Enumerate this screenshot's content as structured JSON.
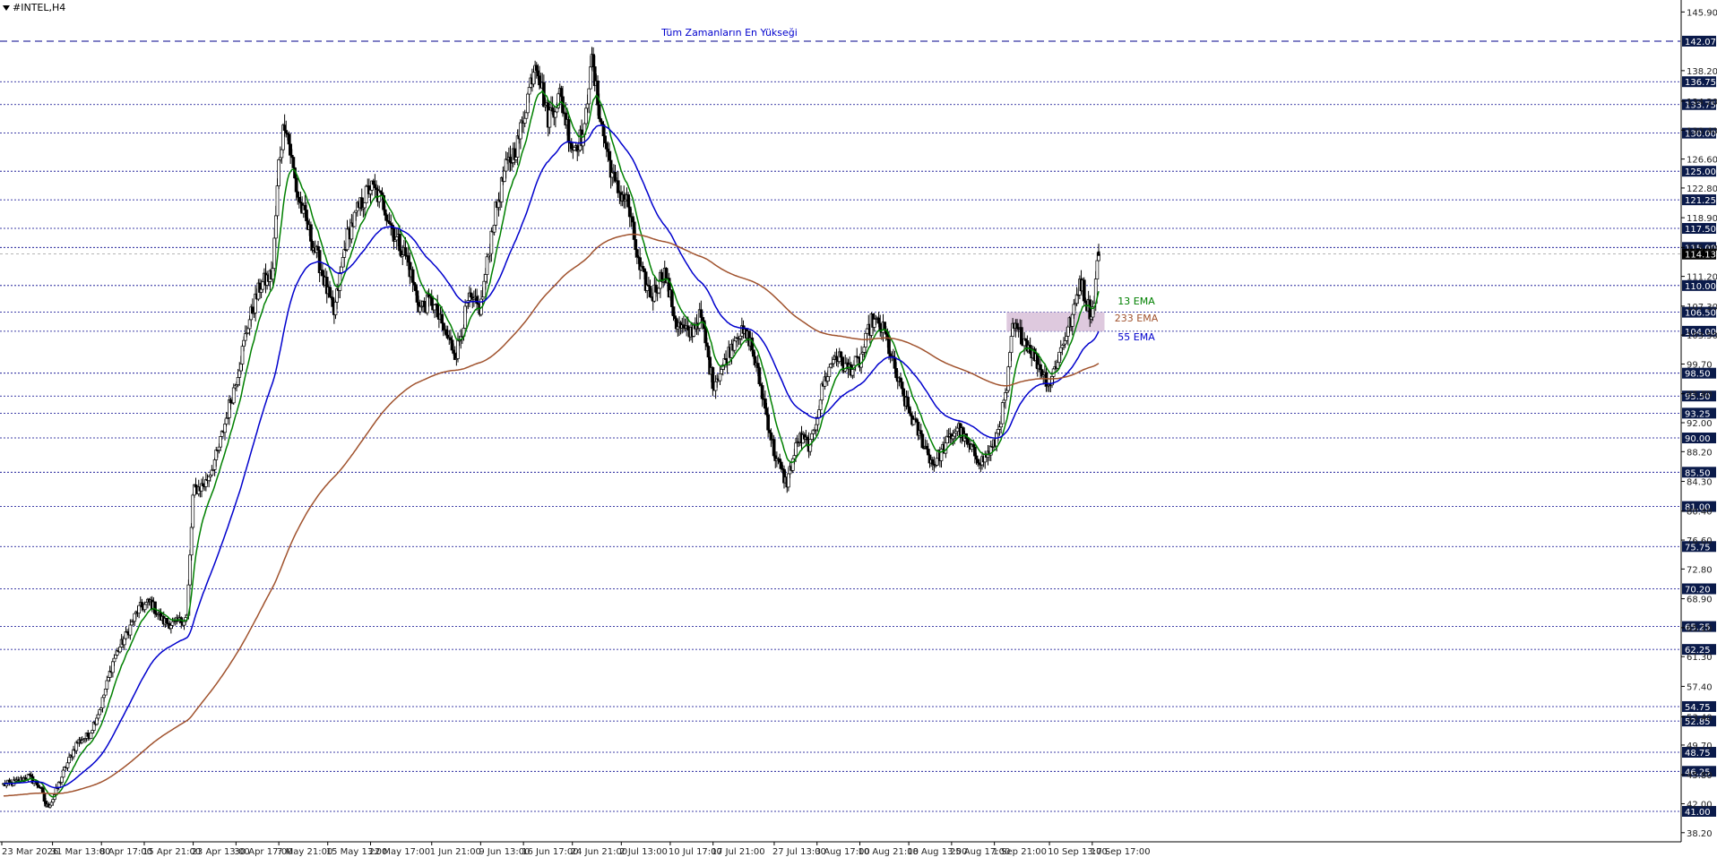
{
  "chart_data": {
    "type": "line",
    "symbol_label": "#INTEL,H4",
    "ylim": [
      37.0,
      147.0
    ],
    "y_ticks": [
      38.2,
      42.0,
      45.8,
      49.7,
      53.4,
      57.4,
      61.3,
      65.1,
      68.9,
      72.8,
      76.6,
      80.4,
      84.3,
      88.2,
      92.0,
      95.8,
      99.7,
      103.5,
      107.3,
      111.2,
      115.0,
      118.9,
      122.8,
      126.6,
      130.4,
      134.2,
      138.2,
      145.9
    ],
    "x_ticks": [
      "23 Mar 2026",
      "31 Mar 13:00",
      "8 Apr 17:00",
      "15 Apr 21:00",
      "23 Apr 13:00",
      "30 Apr 17:00",
      "7 May 21:00",
      "15 May 13:00",
      "22 May 17:00",
      "1 Jun 21:00",
      "9 Jun 13:00",
      "16 Jun 17:00",
      "24 Jun 21:00",
      "2 Jul 13:00",
      "10 Jul 17:00",
      "17 Jul 21:00",
      "27 Jul 13:00",
      "3 Aug 17:00",
      "10 Aug 21:00",
      "18 Aug 13:00",
      "25 Aug 17:00",
      "1 Sep 21:00",
      "10 Sep 13:00",
      "17 Sep 17:00"
    ],
    "levels": [
      142.07,
      136.75,
      133.75,
      130.0,
      125.0,
      121.25,
      117.5,
      115.0,
      110.0,
      106.5,
      104.0,
      98.5,
      95.5,
      93.25,
      90.0,
      85.5,
      81.0,
      75.75,
      70.2,
      65.25,
      62.25,
      54.75,
      52.85,
      48.75,
      46.25,
      41.0
    ],
    "current_price": 114.13,
    "annotation": "Tüm Zamanların En Yükseği",
    "zone": {
      "from_date": "3 Sep 2026",
      "to_date": "19 Sep 2026",
      "y_low": 104.0,
      "y_high": 106.5,
      "color": "#d8bfd8"
    },
    "candle_colors": {
      "up": "#000000",
      "down": "#000000"
    },
    "close_keypoints": [
      [
        "23 Mar 2026",
        44.5
      ],
      [
        "25 Mar 2026",
        44.8
      ],
      [
        "27 Mar 2026",
        45.6
      ],
      [
        "29 Mar 2026",
        44.2
      ],
      [
        "30 Mar 2026",
        41.5
      ],
      [
        "31 Mar 2026",
        42.5
      ],
      [
        "2 Apr 2026",
        46.5
      ],
      [
        "4 Apr 2026",
        50.0
      ],
      [
        "6 Apr 2026",
        51.0
      ],
      [
        "8 Apr 2026",
        55.0
      ],
      [
        "10 Apr 2026",
        61.0
      ],
      [
        "12 Apr 2026",
        64.0
      ],
      [
        "14 Apr 2026",
        67.5
      ],
      [
        "16 Apr 2026",
        68.5
      ],
      [
        "18 Apr 2026",
        66.0
      ],
      [
        "20 Apr 2026",
        65.5
      ],
      [
        "22 Apr 2026",
        66.5
      ],
      [
        "23 Apr 2026",
        83.0
      ],
      [
        "25 Apr 2026",
        84.0
      ],
      [
        "27 Apr 2026",
        88.0
      ],
      [
        "29 Apr 2026",
        94.5
      ],
      [
        "30 Apr 2026",
        97.5
      ],
      [
        "2 May 2026",
        105.0
      ],
      [
        "4 May 2026",
        110.0
      ],
      [
        "6 May 2026",
        111.5
      ],
      [
        "7 May 2026",
        126.0
      ],
      [
        "8 May 2026",
        132.0
      ],
      [
        "10 May 2026",
        122.0
      ],
      [
        "12 May 2026",
        117.0
      ],
      [
        "14 May 2026",
        112.0
      ],
      [
        "16 May 2026",
        106.0
      ],
      [
        "18 May 2026",
        116.0
      ],
      [
        "20 May 2026",
        120.0
      ],
      [
        "22 May 2026",
        123.0
      ],
      [
        "24 May 2026",
        121.0
      ],
      [
        "26 May 2026",
        116.5
      ],
      [
        "28 May 2026",
        113.5
      ],
      [
        "30 May 2026",
        107.0
      ],
      [
        "1 Jun 2026",
        108.0
      ],
      [
        "3 Jun 2026",
        104.0
      ],
      [
        "5 Jun 2026",
        101.0
      ],
      [
        "7 Jun 2026",
        108.0
      ],
      [
        "9 Jun 2026",
        107.0
      ],
      [
        "11 Jun 2026",
        118.0
      ],
      [
        "13 Jun 2026",
        125.0
      ],
      [
        "15 Jun 2026",
        128.5
      ],
      [
        "16 Jun 2026",
        132.0
      ],
      [
        "18 Jun 2026",
        140.0
      ],
      [
        "20 Jun 2026",
        132.0
      ],
      [
        "22 Jun 2026",
        135.0
      ],
      [
        "24 Jun 2026",
        128.0
      ],
      [
        "26 Jun 2026",
        130.0
      ],
      [
        "27 Jun 2026",
        140.0
      ],
      [
        "29 Jun 2026",
        130.0
      ],
      [
        "1 Jul 2026",
        123.0
      ],
      [
        "3 Jul 2026",
        121.0
      ],
      [
        "5 Jul 2026",
        112.0
      ],
      [
        "7 Jul 2026",
        108.5
      ],
      [
        "9 Jul 2026",
        112.0
      ],
      [
        "11 Jul 2026",
        105.0
      ],
      [
        "13 Jul 2026",
        103.5
      ],
      [
        "15 Jul 2026",
        106.0
      ],
      [
        "17 Jul 2026",
        97.0
      ],
      [
        "19 Jul 2026",
        100.0
      ],
      [
        "21 Jul 2026",
        104.0
      ],
      [
        "23 Jul 2026",
        103.0
      ],
      [
        "25 Jul 2026",
        96.0
      ],
      [
        "27 Jul 2026",
        88.0
      ],
      [
        "29 Jul 2026",
        84.0
      ],
      [
        "31 Jul 2026",
        90.0
      ],
      [
        "2 Aug 2026",
        89.0
      ],
      [
        "4 Aug 2026",
        97.0
      ],
      [
        "6 Aug 2026",
        101.0
      ],
      [
        "8 Aug 2026",
        99.0
      ],
      [
        "10 Aug 2026",
        100.0
      ],
      [
        "12 Aug 2026",
        105.5
      ],
      [
        "14 Aug 2026",
        104.0
      ],
      [
        "16 Aug 2026",
        98.0
      ],
      [
        "18 Aug 2026",
        93.5
      ],
      [
        "20 Aug 2026",
        90.0
      ],
      [
        "22 Aug 2026",
        86.5
      ],
      [
        "24 Aug 2026",
        89.0
      ],
      [
        "26 Aug 2026",
        91.5
      ],
      [
        "28 Aug 2026",
        88.5
      ],
      [
        "30 Aug 2026",
        87.0
      ],
      [
        "1 Sep 2026",
        89.0
      ],
      [
        "3 Sep 2026",
        96.0
      ],
      [
        "4 Sep 2026",
        104.5
      ],
      [
        "6 Sep 2026",
        103.0
      ],
      [
        "8 Sep 2026",
        100.0
      ],
      [
        "10 Sep 2026",
        97.0
      ],
      [
        "12 Sep 2026",
        102.0
      ],
      [
        "14 Sep 2026",
        106.5
      ],
      [
        "15 Sep 2026",
        111.0
      ],
      [
        "16 Sep 2026",
        108.0
      ],
      [
        "17 Sep 2026",
        106.0
      ],
      [
        "18 Sep 2026",
        114.13
      ]
    ],
    "series": [
      {
        "name": "13 EMA",
        "color": "#008000",
        "period": 13
      },
      {
        "name": "55 EMA",
        "color": "#0000cd",
        "period": 55
      },
      {
        "name": "233 EMA",
        "color": "#a0522d",
        "period": 233
      }
    ],
    "colors": {
      "level_line": "#00008b",
      "level_label_bg": "#0a1a4a",
      "background": "#ffffff",
      "annotation": "#0000cd"
    }
  }
}
